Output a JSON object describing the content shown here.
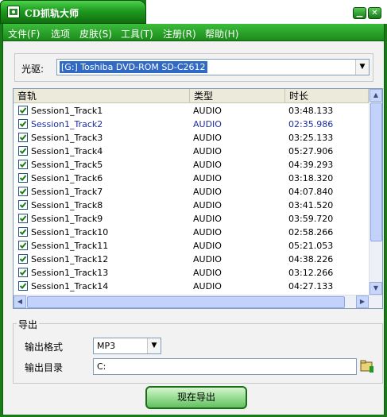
{
  "window": {
    "title": "CD抓轨大师"
  },
  "menu": [
    {
      "label": "文件(F)"
    },
    {
      "label": "选项"
    },
    {
      "label": "皮肤(S)"
    },
    {
      "label": "工具(T)"
    },
    {
      "label": "注册(R)"
    },
    {
      "label": "帮助(H)"
    }
  ],
  "drive": {
    "label": "光驱:",
    "selected": "[G:] Toshiba  DVD-ROM SD-C2612"
  },
  "table": {
    "columns": [
      "音轨",
      "类型",
      "时长"
    ],
    "rows": [
      {
        "name": "Session1_Track1",
        "type": "AUDIO",
        "duration": "03:48.133",
        "checked": true
      },
      {
        "name": "Session1_Track2",
        "type": "AUDIO",
        "duration": "02:35.986",
        "checked": true
      },
      {
        "name": "Session1_Track3",
        "type": "AUDIO",
        "duration": "03:25.133",
        "checked": true
      },
      {
        "name": "Session1_Track4",
        "type": "AUDIO",
        "duration": "05:27.906",
        "checked": true
      },
      {
        "name": "Session1_Track5",
        "type": "AUDIO",
        "duration": "04:39.293",
        "checked": true
      },
      {
        "name": "Session1_Track6",
        "type": "AUDIO",
        "duration": "03:18.320",
        "checked": true
      },
      {
        "name": "Session1_Track7",
        "type": "AUDIO",
        "duration": "04:07.840",
        "checked": true
      },
      {
        "name": "Session1_Track8",
        "type": "AUDIO",
        "duration": "03:41.520",
        "checked": true
      },
      {
        "name": "Session1_Track9",
        "type": "AUDIO",
        "duration": "03:59.720",
        "checked": true
      },
      {
        "name": "Session1_Track10",
        "type": "AUDIO",
        "duration": "02:58.266",
        "checked": true
      },
      {
        "name": "Session1_Track11",
        "type": "AUDIO",
        "duration": "05:21.053",
        "checked": true
      },
      {
        "name": "Session1_Track12",
        "type": "AUDIO",
        "duration": "04:38.226",
        "checked": true
      },
      {
        "name": "Session1_Track13",
        "type": "AUDIO",
        "duration": "03:12.266",
        "checked": true
      },
      {
        "name": "Session1_Track14",
        "type": "AUDIO",
        "duration": "04:27.133",
        "checked": true
      }
    ]
  },
  "export": {
    "legend": "导出",
    "format_label": "输出格式",
    "format_value": "MP3",
    "dir_label": "输出目录",
    "dir_value": "C:",
    "button": "现在导出"
  },
  "icons": {
    "minimize": "minimize-icon",
    "close": "close-icon",
    "folder": "folder-icon"
  },
  "colors": {
    "accent": "#1f9a1f",
    "selection": "#316ac5"
  }
}
